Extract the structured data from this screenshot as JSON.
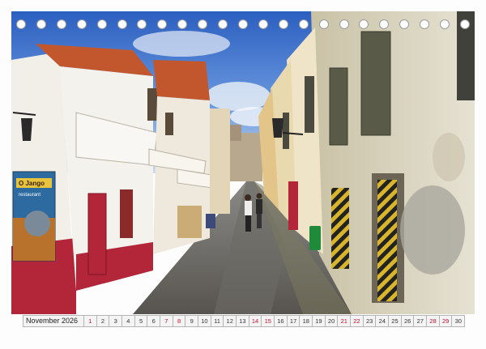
{
  "calendar": {
    "month_label": "November 2026",
    "days": [
      {
        "n": "1",
        "weekend": true
      },
      {
        "n": "2",
        "weekend": false
      },
      {
        "n": "3",
        "weekend": false
      },
      {
        "n": "4",
        "weekend": false
      },
      {
        "n": "5",
        "weekend": false
      },
      {
        "n": "6",
        "weekend": false
      },
      {
        "n": "7",
        "weekend": true
      },
      {
        "n": "8",
        "weekend": true
      },
      {
        "n": "9",
        "weekend": false
      },
      {
        "n": "10",
        "weekend": false
      },
      {
        "n": "11",
        "weekend": false
      },
      {
        "n": "12",
        "weekend": false
      },
      {
        "n": "13",
        "weekend": false
      },
      {
        "n": "14",
        "weekend": true
      },
      {
        "n": "15",
        "weekend": true
      },
      {
        "n": "16",
        "weekend": false
      },
      {
        "n": "17",
        "weekend": false
      },
      {
        "n": "18",
        "weekend": false
      },
      {
        "n": "19",
        "weekend": false
      },
      {
        "n": "20",
        "weekend": false
      },
      {
        "n": "21",
        "weekend": true
      },
      {
        "n": "22",
        "weekend": true
      },
      {
        "n": "23",
        "weekend": false
      },
      {
        "n": "24",
        "weekend": false
      },
      {
        "n": "25",
        "weekend": false
      },
      {
        "n": "26",
        "weekend": false
      },
      {
        "n": "27",
        "weekend": false
      },
      {
        "n": "28",
        "weekend": true
      },
      {
        "n": "29",
        "weekend": true
      },
      {
        "n": "30",
        "weekend": false
      }
    ]
  },
  "photo": {
    "mural_text": "O Jango",
    "mural_subtext": "restaurant"
  },
  "colors": {
    "sky": "#3a6fc9",
    "wall_red": "#b3263a",
    "weekend_text": "#c8102e"
  }
}
